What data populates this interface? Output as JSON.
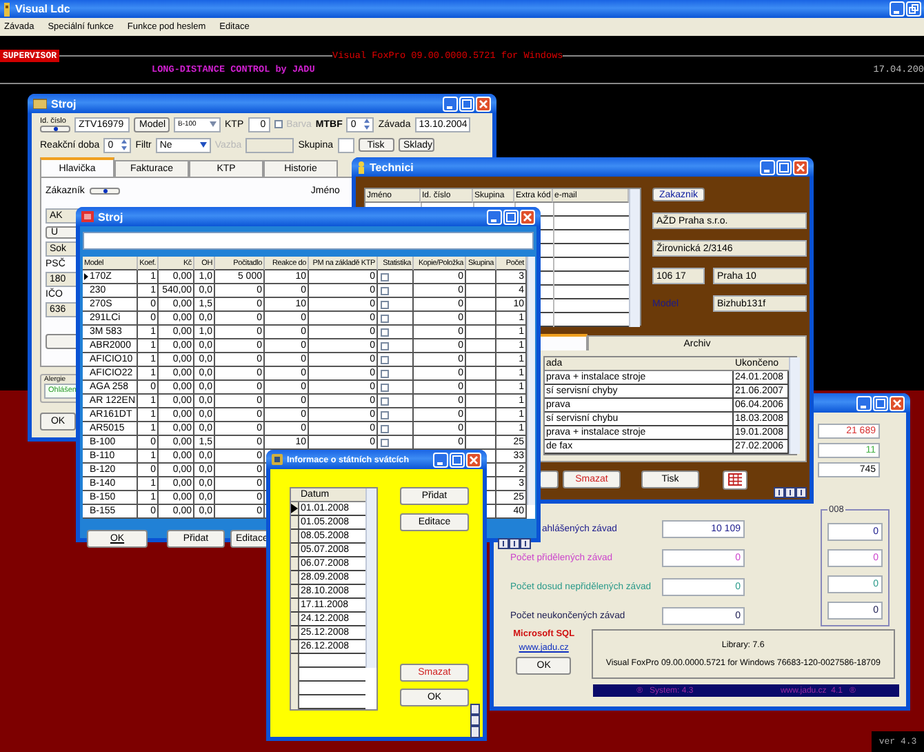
{
  "app": {
    "title": "Visual Ldc",
    "menu": [
      "Závada",
      "Speciální funkce",
      "Funkce pod heslem",
      "Editace"
    ]
  },
  "header": {
    "user": "SUPERVISOR",
    "product": "Visual FoxPro 09.00.0000.5721 for Windows",
    "tagline": "LONG-DISTANCE CONTROL by JADU",
    "date": "17.04.200"
  },
  "machine_back": {
    "title": "Stroj",
    "id_label": "Id. číslo",
    "id_value": "ZTV16979",
    "model_button": "Model",
    "model_value": "B-100",
    "ktp_label": "KTP",
    "ktp_value": "0",
    "color_label": "Barva",
    "color_checked": false,
    "color_disabled": true,
    "mtbf_label": "MTBF",
    "mtbf_value": "0",
    "fault_label": "Závada",
    "fault_value": "13.10.2004",
    "reaction_label": "Reakční doba",
    "reaction_value": "0",
    "filter_label": "Filtr",
    "filter_value": "Ne",
    "link_label": "Vazba",
    "link_disabled": true,
    "group_label": "Skupina",
    "buttons": [
      "Tisk",
      "Sklady"
    ],
    "tabs": [
      {
        "label": "Hlavička",
        "selected": true
      },
      {
        "label": "Fakturace",
        "selected": false
      },
      {
        "label": "KTP",
        "selected": false
      },
      {
        "label": "Historie",
        "selected": false
      }
    ],
    "customer_label": "Zákazník",
    "name_label": "Jméno",
    "side_items": [
      {
        "kind": "field",
        "text": "AK"
      },
      {
        "kind": "button",
        "text": "U"
      },
      {
        "kind": "field",
        "text": "Sok"
      },
      {
        "kind": "label",
        "text": "PSČ"
      },
      {
        "kind": "field",
        "text": "180"
      },
      {
        "kind": "label",
        "text": "IČO"
      },
      {
        "kind": "field",
        "text": "636"
      },
      {
        "kind": "button"
      }
    ],
    "allergy_label": "Alergie",
    "allergy_value": "Ohlášen",
    "ok": "OK"
  },
  "technicians": {
    "title": "Technici",
    "columns": [
      "Jméno",
      "Id. číslo",
      "Skupina",
      "Extra kód",
      "e-mail"
    ],
    "customer_button": "Zakaznik",
    "company": "AŽD Praha s.r.o.",
    "street": "Žirovnická 2/3146",
    "zip": "106 17",
    "city": "Praha 10",
    "model_label": "Model",
    "model_value": "Bizhub131f",
    "tabs": [
      {
        "selected": true
      },
      {
        "label": "Archiv",
        "selected": false
      }
    ],
    "history_columns": [
      "ada",
      "Ukončeno"
    ],
    "history": [
      {
        "task": "prava + instalace stroje",
        "finished": "24.01.2008"
      },
      {
        "task": "sí servisní chyby",
        "finished": "21.06.2007"
      },
      {
        "task": "prava",
        "finished": "06.04.2006"
      },
      {
        "task": "sí servisní chybu",
        "finished": "18.03.2008"
      },
      {
        "task": "prava + instalace stroje",
        "finished": "19.01.2008"
      },
      {
        "task": "de fax",
        "finished": "27.02.2006"
      }
    ],
    "buttons": [
      {
        "kind": "plain"
      },
      {
        "kind": "danger",
        "label": "Smazat"
      },
      {
        "kind": "plain",
        "label": "Tisk"
      },
      {
        "kind": "grid"
      }
    ]
  },
  "stats": {
    "top_values": [
      {
        "text": "21 689",
        "color": "#d83030"
      },
      {
        "text": "11",
        "color": "#40b040"
      },
      {
        "text": "745",
        "color": "#000000"
      }
    ],
    "year_legend": "008",
    "rows": [
      {
        "label": "ahlášených závad",
        "value": "10 109",
        "year_value": "0",
        "color": "#1a1a8c"
      },
      {
        "label": "Počet přidělených závad",
        "value": "0",
        "year_value": "0",
        "color": "#cc44cc"
      },
      {
        "label": "Počet dosud nepřidělených závad",
        "value": "0",
        "year_value": "0",
        "color": "#2a9a8a"
      },
      {
        "label": "Počet neukončených závad",
        "value": "0",
        "year_value": "0",
        "color": "#1a1a50"
      }
    ],
    "database": "Microsoft SQL",
    "website": "www.jadu.cz",
    "ok": "OK",
    "library": "Library: 7.6",
    "product": "Visual FoxPro 09.00.0000.5721 for Windows 76683-120-0027586-18709",
    "status": [
      "®   System: 4.3",
      "www.jadu.cz  4.1   ®"
    ]
  },
  "machine_front": {
    "title": "Stroj",
    "columns": [
      "Model",
      "Koef.",
      "Kč",
      "OH",
      "Počitadlo",
      "Reakce do",
      "PM na základě KTP",
      "Statistika",
      "Kopie/Položka",
      "Skupina",
      "Počet"
    ],
    "rows": [
      {
        "selected": true,
        "model": "170Z",
        "koef": "1",
        "kc": "0,00",
        "oh": "1,0",
        "counter": "5 000",
        "reaction": "10",
        "pm_ktp": "0",
        "statistics": false,
        "copies": "0",
        "count": "3"
      },
      {
        "selected": false,
        "model": "230",
        "koef": "1",
        "kc": "540,00",
        "oh": "0,0",
        "counter": "0",
        "reaction": "0",
        "pm_ktp": "0",
        "statistics": false,
        "copies": "0",
        "count": "4"
      },
      {
        "selected": false,
        "model": "270S",
        "koef": "0",
        "kc": "0,00",
        "oh": "1,5",
        "counter": "0",
        "reaction": "10",
        "pm_ktp": "0",
        "statistics": false,
        "copies": "0",
        "count": "10"
      },
      {
        "selected": false,
        "model": "291LCi",
        "koef": "0",
        "kc": "0,00",
        "oh": "0,0",
        "counter": "0",
        "reaction": "0",
        "pm_ktp": "0",
        "statistics": false,
        "copies": "0",
        "count": "1"
      },
      {
        "selected": false,
        "model": "3M 583",
        "koef": "1",
        "kc": "0,00",
        "oh": "1,0",
        "counter": "0",
        "reaction": "0",
        "pm_ktp": "0",
        "statistics": false,
        "copies": "0",
        "count": "1"
      },
      {
        "selected": false,
        "model": "ABR2000",
        "koef": "1",
        "kc": "0,00",
        "oh": "0,0",
        "counter": "0",
        "reaction": "0",
        "pm_ktp": "0",
        "statistics": false,
        "copies": "0",
        "count": "1"
      },
      {
        "selected": false,
        "model": "AFICIO10",
        "koef": "1",
        "kc": "0,00",
        "oh": "0,0",
        "counter": "0",
        "reaction": "0",
        "pm_ktp": "0",
        "statistics": false,
        "copies": "0",
        "count": "1"
      },
      {
        "selected": false,
        "model": "AFICIO22",
        "koef": "1",
        "kc": "0,00",
        "oh": "0,0",
        "counter": "0",
        "reaction": "0",
        "pm_ktp": "0",
        "statistics": false,
        "copies": "0",
        "count": "1"
      },
      {
        "selected": false,
        "model": "AGA 258",
        "koef": "0",
        "kc": "0,00",
        "oh": "0,0",
        "counter": "0",
        "reaction": "0",
        "pm_ktp": "0",
        "statistics": false,
        "copies": "0",
        "count": "1"
      },
      {
        "selected": false,
        "model": "AR 122EN",
        "koef": "1",
        "kc": "0,00",
        "oh": "0,0",
        "counter": "0",
        "reaction": "0",
        "pm_ktp": "0",
        "statistics": false,
        "copies": "0",
        "count": "1"
      },
      {
        "selected": false,
        "model": "AR161DT",
        "koef": "1",
        "kc": "0,00",
        "oh": "0,0",
        "counter": "0",
        "reaction": "0",
        "pm_ktp": "0",
        "statistics": false,
        "copies": "0",
        "count": "1"
      },
      {
        "selected": false,
        "model": "AR5015",
        "koef": "1",
        "kc": "0,00",
        "oh": "0,0",
        "counter": "0",
        "reaction": "0",
        "pm_ktp": "0",
        "statistics": false,
        "copies": "0",
        "count": "1"
      },
      {
        "selected": false,
        "model": "B-100",
        "koef": "0",
        "kc": "0,00",
        "oh": "1,5",
        "counter": "0",
        "reaction": "10",
        "pm_ktp": "0",
        "statistics": false,
        "copies": "0",
        "count": "25"
      },
      {
        "selected": false,
        "model": "B-110",
        "koef": "1",
        "kc": "0,00",
        "oh": "0,0",
        "counter": "0",
        "count": "33"
      },
      {
        "selected": false,
        "model": "B-120",
        "koef": "0",
        "kc": "0,00",
        "oh": "0,0",
        "counter": "0",
        "count": "2"
      },
      {
        "selected": false,
        "model": "B-140",
        "koef": "1",
        "kc": "0,00",
        "oh": "0,0",
        "counter": "0",
        "count": "3"
      },
      {
        "selected": false,
        "model": "B-150",
        "koef": "1",
        "kc": "0,00",
        "oh": "0,0",
        "counter": "0",
        "count": "25"
      },
      {
        "selected": false,
        "model": "B-155",
        "koef": "0",
        "kc": "0,00",
        "oh": "0,0",
        "counter": "0",
        "count": "40"
      }
    ],
    "buttons": [
      {
        "kind": "ok",
        "label": "OK"
      },
      {
        "kind": "plain",
        "label": "Přidat"
      },
      {
        "kind": "plain",
        "label": "Editace"
      }
    ]
  },
  "holidays": {
    "title": "Informace o státních svátcích",
    "column": "Datum",
    "dates": [
      {
        "text": "01.01.2008",
        "selected": true
      },
      {
        "text": "01.05.2008",
        "selected": false
      },
      {
        "text": "08.05.2008",
        "selected": false
      },
      {
        "text": "05.07.2008",
        "selected": false
      },
      {
        "text": "06.07.2008",
        "selected": false
      },
      {
        "text": "28.09.2008",
        "selected": false
      },
      {
        "text": "28.10.2008",
        "selected": false
      },
      {
        "text": "17.11.2008",
        "selected": false
      },
      {
        "text": "24.12.2008",
        "selected": false
      },
      {
        "text": "25.12.2008",
        "selected": false
      },
      {
        "text": "26.12.2008",
        "selected": false
      }
    ],
    "buttons": [
      {
        "kind": "plain",
        "label": "Přidat"
      },
      {
        "kind": "plain",
        "label": "Editace"
      },
      {
        "kind": "danger",
        "label": "Smazat"
      },
      {
        "kind": "plain",
        "label": "OK"
      }
    ]
  },
  "version": "ver 4.3"
}
